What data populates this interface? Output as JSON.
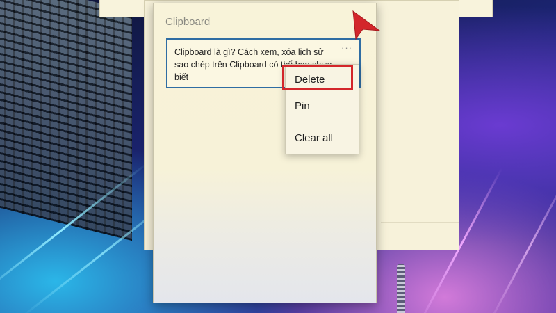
{
  "clipboard": {
    "title": "Clipboard",
    "item": {
      "text": "Clipboard là gì? Cách xem, xóa lịch sử sao chép trên Clipboard có thể bạn chưa biết",
      "more_label": "···"
    }
  },
  "context_menu": {
    "items": [
      {
        "label": "Delete",
        "highlighted": true
      },
      {
        "label": "Pin"
      },
      {
        "label": "Clear all"
      }
    ]
  },
  "colors": {
    "highlight": "#d3262b",
    "card_border": "#2f6da3",
    "panel_bg": "#f8f3d9"
  },
  "annotation": {
    "arrow_icon": "red-pointer-arrow-icon"
  }
}
